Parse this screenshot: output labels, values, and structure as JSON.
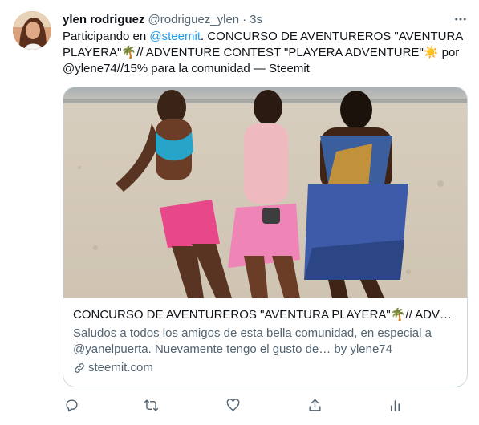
{
  "tweet": {
    "author_name": "ylen rodriguez",
    "author_handle": "@rodriguez_ylen",
    "separator": "·",
    "time": "3s",
    "text_before": "Participando en ",
    "mention": "@steemit",
    "text_after": ". CONCURSO DE AVENTUREROS \"AVENTURA PLAYERA\"🌴// ADVENTURE CONTEST \"PLAYERA ADVENTURE\"☀️ por @ylene74//15% para la comunidad — Steemit"
  },
  "card": {
    "title": "CONCURSO DE AVENTUREROS \"AVENTURA PLAYERA\"🌴// ADVENTURE CONTEST \"PLAYERA ADVENTURE\"☀️",
    "description": "Saludos a todos los amigos de esta bella comunidad, en especial a @yanelpuerta. Nuevamente tengo el gusto de… by ylene74",
    "domain": "steemit.com"
  },
  "icons": {
    "more": "more-horizontal-icon",
    "reply": "reply-icon",
    "retweet": "retweet-icon",
    "like": "like-icon",
    "share": "share-icon",
    "analytics": "analytics-icon",
    "link": "link-icon"
  },
  "colors": {
    "accent": "#1d9bf0",
    "secondary_text": "#536471",
    "border": "#cfd9de"
  }
}
